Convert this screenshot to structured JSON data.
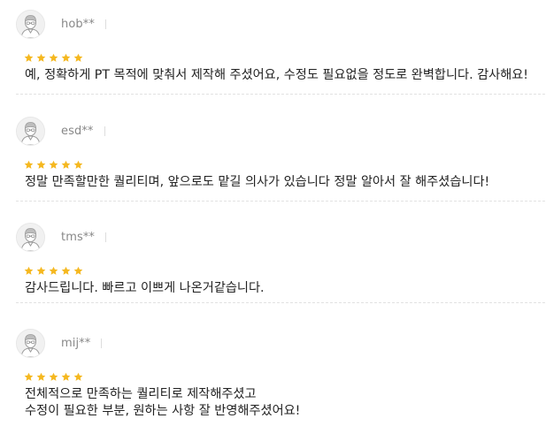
{
  "colors": {
    "star": "#f5b820",
    "name": "#888888",
    "text": "#222222",
    "divider": "#e2e2e2"
  },
  "reviews": [
    {
      "user": "hob**",
      "rating": 5,
      "lines": [
        "예, 정확하게 PT 목적에 맞춰서 제작해 주셨어요, 수정도 필요없을 정도로 완벽합니다. 감사해요!"
      ]
    },
    {
      "user": "esd**",
      "rating": 5,
      "lines": [
        "정말 만족할만한 퀄리티며, 앞으로도 맡길 의사가 있습니다 정말 알아서 잘 해주셨습니다!"
      ]
    },
    {
      "user": "tms**",
      "rating": 5,
      "lines": [
        "감사드립니다. 빠르고 이쁘게 나온거같습니다."
      ]
    },
    {
      "user": "mij**",
      "rating": 5,
      "lines": [
        "전체적으로 만족하는 퀄리티로 제작해주셨고",
        "수정이 필요한 부분, 원하는 사항 잘 반영해주셨어요!"
      ]
    }
  ]
}
